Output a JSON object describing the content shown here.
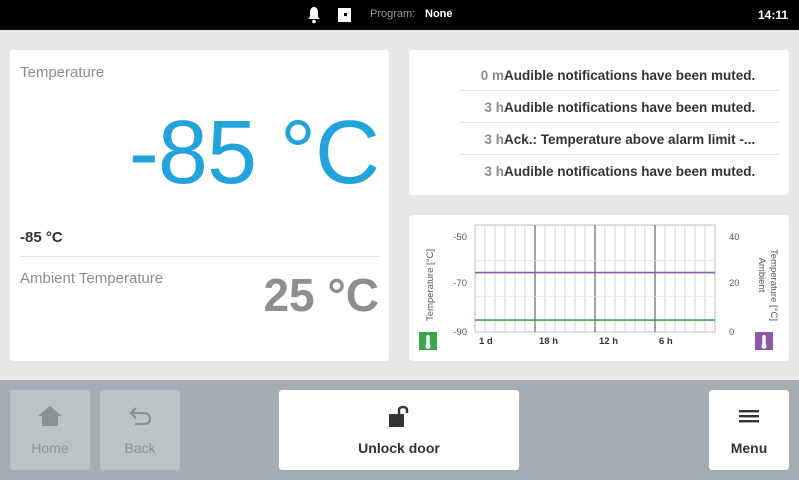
{
  "status_bar": {
    "program_label": "Program:",
    "program_value": "None",
    "time": "14:11",
    "icons": [
      "bell-icon",
      "door-icon"
    ]
  },
  "temperature": {
    "title": "Temperature",
    "value": "-85 °C",
    "setpoint": "-85 °C"
  },
  "ambient": {
    "title": "Ambient Temperature",
    "value": "25 °C"
  },
  "notifications": [
    {
      "time": "0 m",
      "message": "Audible notifications have been muted."
    },
    {
      "time": "3 h",
      "message": "Audible notifications have been muted."
    },
    {
      "time": "3 h",
      "message": "Ack.: Temperature above alarm limit -..."
    },
    {
      "time": "3 h",
      "message": "Audible notifications have been muted."
    }
  ],
  "chart_data": {
    "type": "line",
    "left_axis_label": "Temperature [°C]",
    "right_axis_label_line1": "Ambient",
    "right_axis_label_line2": "Temperature [°C]",
    "left_ticks": [
      "-50",
      "-70",
      "-90"
    ],
    "right_ticks": [
      "40",
      "20",
      "0"
    ],
    "x_ticks": [
      "1 d",
      "18 h",
      "12 h",
      "6 h"
    ],
    "left_ylim": [
      -90,
      -50
    ],
    "right_ylim": [
      0,
      40
    ],
    "series": [
      {
        "axis": "left",
        "color": "#3aa54a",
        "values": [
          -85,
          -85,
          -85,
          -85,
          -85,
          -85,
          -85,
          -85
        ]
      },
      {
        "axis": "right",
        "color": "#8a5aa6",
        "values": [
          25,
          25,
          25,
          25,
          25,
          25,
          25,
          25
        ]
      }
    ],
    "grid": true
  },
  "bottom_bar": {
    "home_label": "Home",
    "back_label": "Back",
    "unlock_label": "Unlock door",
    "menu_label": "Menu"
  },
  "colors": {
    "accent": "#23a3dc",
    "temp_series": "#3aa54a",
    "ambient_series": "#8a5aa6"
  }
}
